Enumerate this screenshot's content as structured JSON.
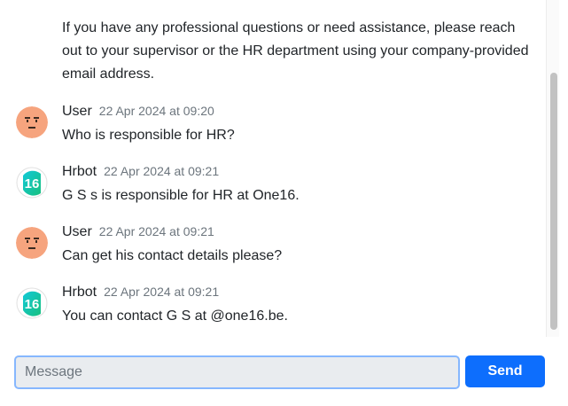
{
  "conversation": {
    "continuation_text": "If you have any professional questions or need assistance, please reach out to your supervisor or the HR department using your company-provided email address.",
    "messages": [
      {
        "sender": "User",
        "timestamp": "22 Apr 2024 at 09:20",
        "text": "Who is responsible for HR?",
        "avatar": "user-face-icon"
      },
      {
        "sender": "Hrbot",
        "timestamp": "22 Apr 2024 at 09:21",
        "text": "G        S            s is responsible for HR at One16.",
        "avatar": "one16-logo-icon"
      },
      {
        "sender": "User",
        "timestamp": "22 Apr 2024 at 09:21",
        "text": "Can get his contact details please?",
        "avatar": "user-face-icon"
      },
      {
        "sender": "Hrbot",
        "timestamp": "22 Apr 2024 at 09:21",
        "text": "You can contact G        S              at              @one16.be.",
        "avatar": "one16-logo-icon"
      }
    ]
  },
  "bot_logo_text": "16",
  "composer": {
    "placeholder": "Message",
    "value": "",
    "send_label": "Send"
  },
  "colors": {
    "accent": "#0d6efd",
    "input_border": "#86b7fe",
    "input_bg": "#e9ecef",
    "user_avatar": "#f6a47e",
    "bot_logo_gradient": [
      "#12c9d8",
      "#18c07f"
    ]
  }
}
